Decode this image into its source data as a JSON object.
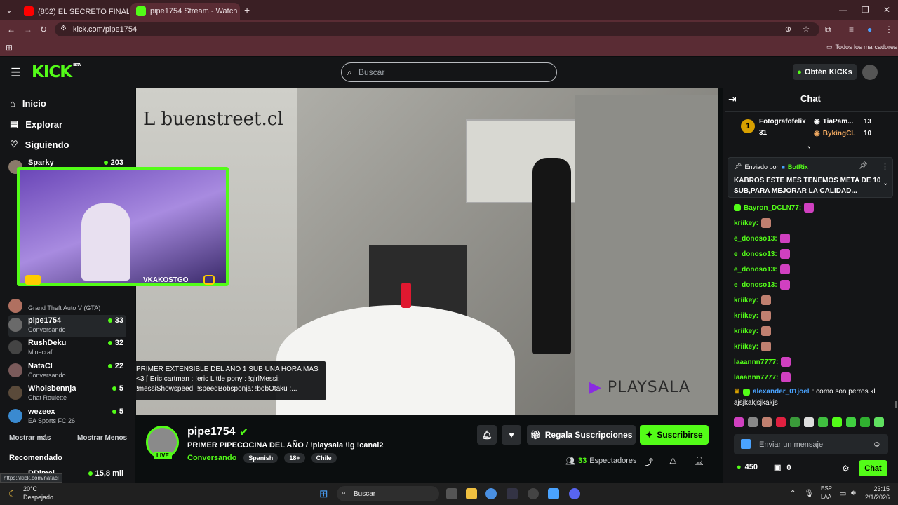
{
  "browser": {
    "tabs": [
      {
        "label": "(852) EL SECRETO FINAL🙈 Cap..."
      },
      {
        "label": "pipe1754 Stream - Watch L..."
      }
    ],
    "url": "kick.com/pipe1754",
    "bookmarks_label": "Todos los marcadores",
    "status_url": "https://kick.com/natacl"
  },
  "header": {
    "logo": "KICK",
    "logo_badge": "BETA",
    "search_placeholder": "Buscar",
    "kicks_button": "Obtén KICKs"
  },
  "sidebar": {
    "nav": [
      "Inicio",
      "Explorar",
      "Siguiendo"
    ],
    "channels": [
      {
        "name": "Sparky",
        "viewers": "203",
        "sub": ""
      },
      {
        "name": "",
        "viewers": "",
        "sub": "Grand Theft Auto V (GTA)"
      },
      {
        "name": "pipe1754",
        "viewers": "33",
        "sub": "Conversando"
      },
      {
        "name": "RushDeku",
        "viewers": "32",
        "sub": "Minecraft"
      },
      {
        "name": "NataCl",
        "viewers": "22",
        "sub": "Conversando"
      },
      {
        "name": "Whoisbennja",
        "viewers": "5",
        "sub": "Chat Roulette"
      },
      {
        "name": "wezeex",
        "viewers": "5",
        "sub": "EA Sports FC 26"
      }
    ],
    "show_more": "Mostrar más",
    "show_less": "Mostrar Menos",
    "recommended": "Recomendado",
    "recommended_first": {
      "name": "DDimel",
      "viewers": "15,8 mil"
    }
  },
  "video": {
    "cam_label": "VKAKOSTGO",
    "caption": "PRIMER EXTENSIBLE DEL AÑO 1 SUB UNA HORA MAS <3 [ Eric cartman : !eric Little pony : !girlMessi: !messiShowspeed: !speedBobsponja: !bobOtaku :...",
    "watermark": "PLAYSALA",
    "wall_sign": "L  buenstreet.cl"
  },
  "stream": {
    "channel": "pipe1754",
    "title": "PRIMER PIPECOCINA DEL AÑO / !playsala !ig !canal2",
    "category": "Conversando",
    "tags": [
      "Spanish",
      "18+",
      "Chile"
    ],
    "live": "LIVE",
    "gift_button": "Regala Suscripciones",
    "subscribe_button": "Suscribirse",
    "viewers_count": "33",
    "viewers_label": "Espectadores"
  },
  "chat": {
    "title": "Chat",
    "leaderboard": [
      {
        "rank": "1",
        "name": "Fotografofelix",
        "value": "31"
      },
      {
        "name": "TiaPam...",
        "value": "13"
      },
      {
        "name": "BykingCL",
        "value": "10"
      }
    ],
    "pinned_prefix": "Enviado por",
    "pinned_by": "BotRix",
    "pinned_text": "KABROS ESTE MES TENEMOS META DE 10 SUB,PARA MEJORAR LA CALIDAD...",
    "messages": [
      {
        "user": "Bayron_DCLN77:",
        "text": ""
      },
      {
        "user": "kriikey:",
        "text": ""
      },
      {
        "user": "e_donoso13:",
        "text": ""
      },
      {
        "user": "e_donoso13:",
        "text": ""
      },
      {
        "user": "e_donoso13:",
        "text": ""
      },
      {
        "user": "e_donoso13:",
        "text": ""
      },
      {
        "user": "kriikey:",
        "text": ""
      },
      {
        "user": "kriikey:",
        "text": ""
      },
      {
        "user": "kriikey:",
        "text": ""
      },
      {
        "user": "kriikey:",
        "text": ""
      },
      {
        "user": "laaannn7777:",
        "text": ""
      },
      {
        "user": "laaannn7777:",
        "text": ""
      }
    ],
    "last_user": "alexander_01joel",
    "last_text_1": ": como son perros kl",
    "last_text_2": "ajsjkakjsjkakjs",
    "input_placeholder": "Enviar un mensaje",
    "kicks_count": "450",
    "gifts_count": "0",
    "send_button": "Chat"
  },
  "taskbar": {
    "weather_temp": "20°C",
    "weather_desc": "Despejado",
    "search": "Buscar",
    "lang_1": "ESP",
    "lang_2": "LAA",
    "time": "23:15",
    "date": "2/1/2026"
  },
  "colors": {
    "accent": "#53fc18",
    "background": "#0b0e0f",
    "panel": "#141517",
    "browser": "#5a2c34"
  }
}
